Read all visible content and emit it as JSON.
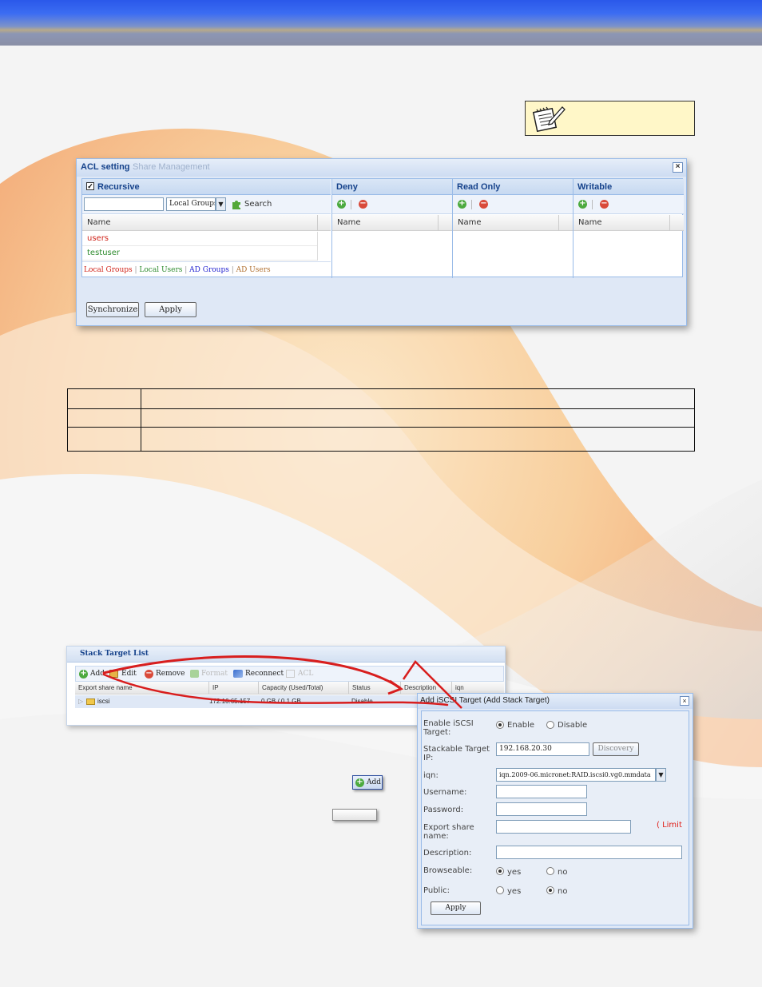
{
  "acl": {
    "title": "ACL setting",
    "ghost_title": "Share Management",
    "recursive_label": "Recursive",
    "filter_input_value": "",
    "filter_select": "Local Groups",
    "search_label": "Search",
    "name_header": "Name",
    "items": [
      {
        "label": "users",
        "color": "#d0241a"
      },
      {
        "label": "testuser",
        "color": "#2e8b2e"
      }
    ],
    "deny_header": "Deny",
    "readonly_header": "Read Only",
    "writable_header": "Writable",
    "legend": [
      {
        "label": "Local Groups",
        "color": "#d0241a"
      },
      {
        "label": "Local Users",
        "color": "#2e8b2e"
      },
      {
        "label": "AD Groups",
        "color": "#2424d0"
      },
      {
        "label": "AD Users",
        "color": "#b07030"
      }
    ],
    "synchronize_label": "Synchronize",
    "apply_label": "Apply"
  },
  "stack_list": {
    "title": "Stack Target List",
    "toolbar": {
      "add": "Add",
      "edit": "Edit",
      "remove": "Remove",
      "format": "Format",
      "reconnect": "Reconnect",
      "acl": "ACL"
    },
    "columns": [
      "Export share name",
      "IP",
      "Capacity (Used/Total)",
      "Status",
      "Description",
      "iqn"
    ],
    "rows": [
      {
        "name": "iscsi",
        "ip": "172.16.65.157",
        "capacity": "0 GB / 0.1 GB",
        "status": "Disable",
        "description": "",
        "iqn": ""
      }
    ]
  },
  "add_button_label": "Add",
  "dialog": {
    "title": "Add iSCSI Target (Add Stack Target)",
    "enable_label": "Enable iSCSI Target:",
    "enable_option": "Enable",
    "disable_option": "Disable",
    "ip_label": "Stackable Target IP:",
    "ip_value": "192.168.20.30",
    "discovery_label": "Discovery",
    "iqn_label": "iqn:",
    "iqn_value": "iqn.2009-06.micronet:RAID.iscsi0.vg0.mmdata",
    "username_label": "Username:",
    "username_value": "",
    "password_label": "Password:",
    "password_value": "",
    "export_label": "Export share name:",
    "export_value": "",
    "limit_label": "( Limit",
    "description_label": "Description:",
    "description_value": "",
    "browseable_label": "Browseable:",
    "public_label": "Public:",
    "yes_label": "yes",
    "no_label": "no",
    "apply_label": "Apply"
  }
}
